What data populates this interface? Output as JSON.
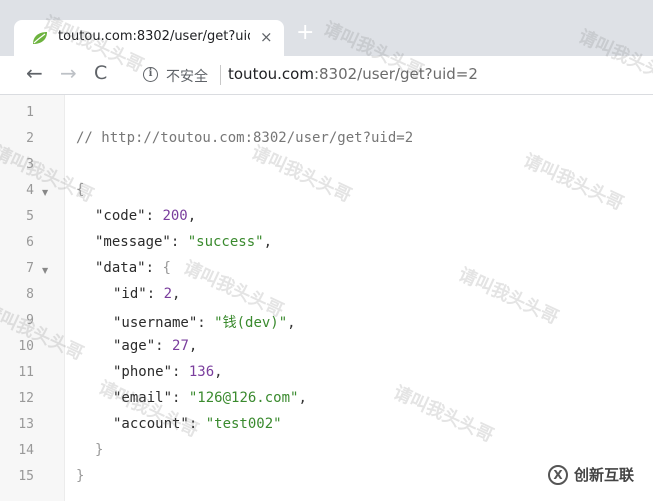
{
  "browser": {
    "tab_title": "toutou.com:8302/user/get?uid",
    "tab_close_label": "×",
    "new_tab_label": "+",
    "back_label": "←",
    "forward_label": "→",
    "reload_label": "C",
    "info_label": "i",
    "security_text": "不安全",
    "url_host": "toutou.com",
    "url_rest": ":8302/user/get?uid=2"
  },
  "editor": {
    "line_numbers": [
      "1",
      "2",
      "3",
      "4",
      "5",
      "6",
      "7",
      "8",
      "9",
      "10",
      "11",
      "12",
      "13",
      "14",
      "15"
    ],
    "fold_marker": "▼",
    "comment": "// http://toutou.com:8302/user/get?uid=2",
    "open_brace": "{",
    "fields": {
      "code_key": "\"code\"",
      "code_value": "200",
      "message_key": "\"message\"",
      "message_value": "\"success\"",
      "data_key": "\"data\"",
      "id_key": "\"id\"",
      "id_value": "2",
      "username_key": "\"username\"",
      "username_value": "\"钱(dev)\"",
      "age_key": "\"age\"",
      "age_value": "27",
      "phone_key": "\"phone\"",
      "phone_value": "136",
      "email_key": "\"email\"",
      "email_value": "\"126@126.com\"",
      "account_key": "\"account\"",
      "account_value": "\"test002\""
    },
    "colon": ": ",
    "comma": ",",
    "data_open": "{",
    "data_close": "}",
    "close_brace": "}"
  },
  "watermark": {
    "text": "请叫我头头哥"
  },
  "logo": {
    "mark": "X",
    "text": "创新互联"
  }
}
